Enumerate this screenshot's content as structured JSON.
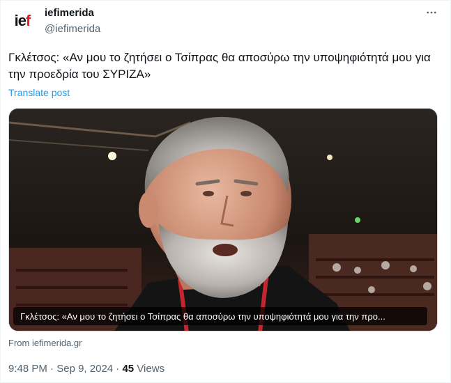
{
  "author": {
    "name": "iefimerida",
    "handle": "@iefimerida",
    "avatar_text_main": "ie",
    "avatar_text_accent": "f"
  },
  "tweet": {
    "text": "Γκλέτσος: «Αν μου το ζητήσει ο Τσίπρας θα αποσύρω την υποψηφιότητά μου για την προεδρία του ΣΥΡΙΖΑ»",
    "translate_label": "Translate post"
  },
  "media": {
    "caption": "Γκλέτσος: «Αν μου το ζητήσει ο Τσίπρας θα αποσύρω την υποψηφιότητά μου για την προ..."
  },
  "source": "From iefimerida.gr",
  "meta": {
    "time": "9:48 PM",
    "separator": "·",
    "date": "Sep 9, 2024",
    "views_count": "45",
    "views_label": "Views"
  },
  "colors": {
    "accent": "#1d9bf0",
    "secondary_text": "#536471",
    "primary_text": "#0f1419",
    "brand_red": "#e11d2b"
  },
  "icons": [
    "more-options-icon"
  ]
}
